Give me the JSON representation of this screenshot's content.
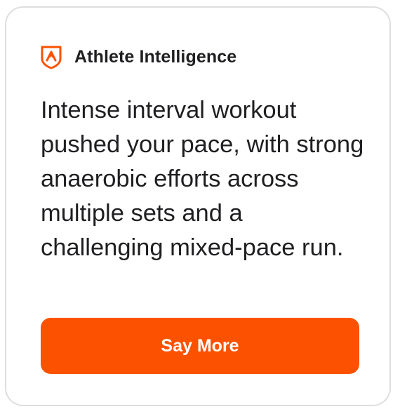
{
  "card": {
    "header": {
      "icon": "athlete-intelligence-shield-icon",
      "title": "Athlete Intelligence"
    },
    "summary": "Intense interval workout pushed your pace, with strong anaerobic efforts across multiple sets and a challenging mixed-pace run.",
    "button": {
      "label": "Say More"
    }
  },
  "colors": {
    "accent": "#fc5200",
    "text": "#1f1f22",
    "card_border": "#dedede",
    "background": "#ffffff"
  }
}
